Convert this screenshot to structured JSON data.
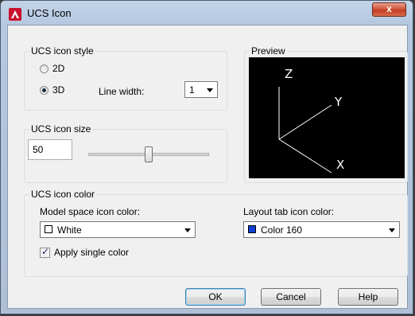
{
  "window": {
    "title": "UCS Icon",
    "close_label": "x"
  },
  "style_group": {
    "label": "UCS icon style",
    "option_2d": "2D",
    "option_3d": "3D",
    "selected": "3D",
    "line_width_label": "Line width:",
    "line_width_value": "1"
  },
  "preview": {
    "label": "Preview",
    "axis_z": "Z",
    "axis_y": "Y",
    "axis_x": "X"
  },
  "size_group": {
    "label": "UCS icon size",
    "value": "50",
    "slider_fraction": 0.5
  },
  "color_group": {
    "label": "UCS icon color",
    "model_label": "Model space icon color:",
    "model_value": "White",
    "model_swatch": "#ffffff",
    "layout_label": "Layout tab icon color:",
    "layout_value": "Color 160",
    "layout_swatch": "#1040d0",
    "apply_single_label": "Apply single color",
    "apply_single_checked": true
  },
  "buttons": {
    "ok": "OK",
    "cancel": "Cancel",
    "help": "Help"
  }
}
